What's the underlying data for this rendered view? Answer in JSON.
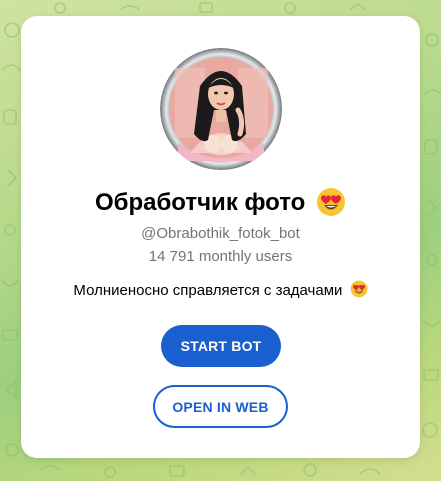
{
  "bot": {
    "name": "Обработчик фото",
    "name_emoji": "heart-eyes-emoji",
    "username": "@Obrabothik_fotok_bot",
    "monthly_users": "14 791 monthly users",
    "description": "Молниеносно справляется с задачами",
    "description_emoji": "heart-eyes-emoji",
    "avatar": "bot-avatar-portrait"
  },
  "actions": {
    "start_label": "START BOT",
    "web_label": "OPEN IN WEB"
  },
  "colors": {
    "accent": "#1a5fd0",
    "secondary_text": "#707579",
    "card_bg": "#ffffff",
    "background_green": "#b7d98a"
  }
}
